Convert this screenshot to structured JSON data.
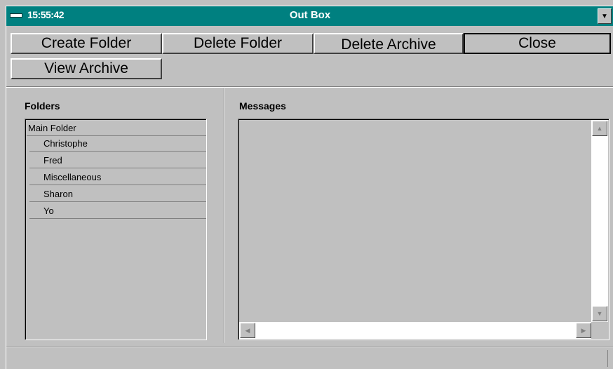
{
  "window": {
    "clock": "15:55:42",
    "title": "Out Box",
    "dropdown_icon": "triangle-down",
    "accent_color": "#008080"
  },
  "toolbar": {
    "create_folder": "Create Folder",
    "delete_folder": "Delete Folder",
    "delete_archive": "Delete Archive",
    "close": "Close",
    "view_archive": "View Archive"
  },
  "folders": {
    "label": "Folders",
    "root": "Main Folder",
    "items": [
      "Christophe",
      "Fred",
      "Miscellaneous",
      "Sharon",
      "Yo"
    ]
  },
  "messages": {
    "label": "Messages"
  }
}
